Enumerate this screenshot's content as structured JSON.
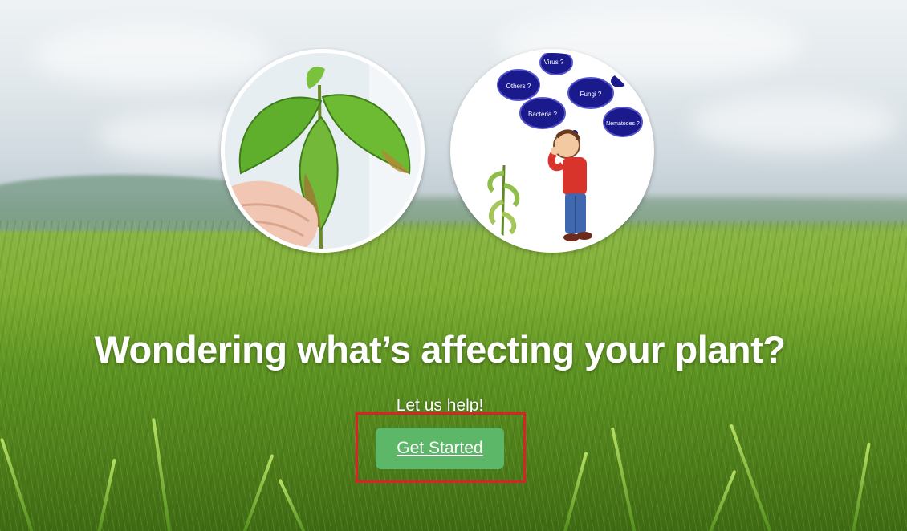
{
  "hero": {
    "headline": "Wondering what’s affecting your plant?",
    "subheadline": "Let us help!",
    "cta_label": "Get Started"
  },
  "illustration": {
    "thought_bubbles": [
      "Others ?",
      "Virus ?",
      "Fungi ?",
      "Bacteria ?",
      "Nematodes ?"
    ]
  },
  "colors": {
    "cta_background": "#5cb768",
    "highlight_border": "#d8232a",
    "text": "#ffffff"
  }
}
